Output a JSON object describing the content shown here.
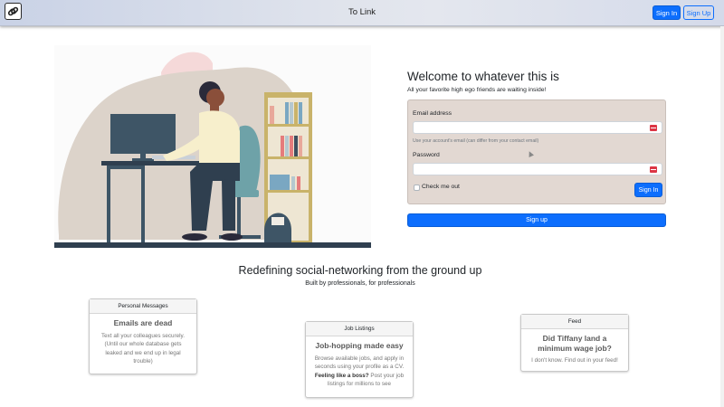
{
  "nav": {
    "logo_icon": "link-icon",
    "title": "To Link",
    "signin_label": "Sign In",
    "signup_label": "Sign Up"
  },
  "hero": {
    "illustration": "person-working-at-desk-illustration"
  },
  "welcome": {
    "title": "Welcome to whatever this is",
    "subtitle": "All your favorite high ego friends are waiting inside!"
  },
  "login_form": {
    "email_label": "Email address",
    "email_value": "",
    "email_help": "Use your account's email (can differ from your contact email)",
    "password_label": "Password",
    "password_value": "",
    "field_icon": "password-manager-icon",
    "remember_label": "Check me out",
    "remember_checked": false,
    "signin_label": "Sign In"
  },
  "signup_button_label": "Sign up",
  "section": {
    "title": "Redefining social-networking from the ground up",
    "subtitle": "Built by professionals, for professionals"
  },
  "cards": [
    {
      "header": "Personal Messages",
      "title": "Emails are dead",
      "text": "Text all your colleagues securely. (Until our whole database gets leaked and we end up in legal trouble)"
    },
    {
      "header": "Job Listings",
      "title": "Job-hopping made easy",
      "text_pre": "Browse available jobs, and apply in seconds using your profile as a CV.",
      "text_bold": "Feeling like a boss?",
      "text_post": "Post your job listings for millions to see"
    },
    {
      "header": "Feed",
      "title": "Did Tiffany land a minimum wage job?",
      "text": "I don't know. Find out in your feed!"
    }
  ],
  "colors": {
    "primary": "#0d6efd",
    "form_bg": "#e2d8d2",
    "field_icon": "#dc3545"
  }
}
